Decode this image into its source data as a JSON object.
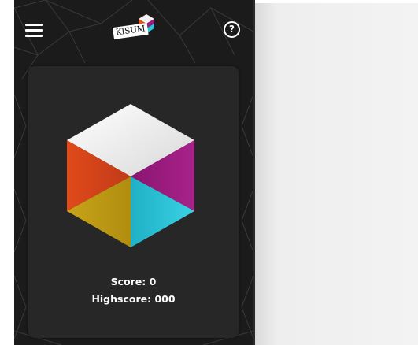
{
  "header": {
    "menu_icon": "hamburger-menu-icon",
    "logo_text": "KISUM",
    "help_icon": "help-circle-icon",
    "help_glyph": "?"
  },
  "game": {
    "score_label": "Score: 0",
    "highscore_label": "Highscore: 000",
    "cube_colors": {
      "top": "#f2f2f2",
      "upper_left": "#e2541e",
      "upper_right": "#9b1a7e",
      "lower_left": "#c9a71a",
      "lower_right": "#2cc6d8"
    }
  }
}
